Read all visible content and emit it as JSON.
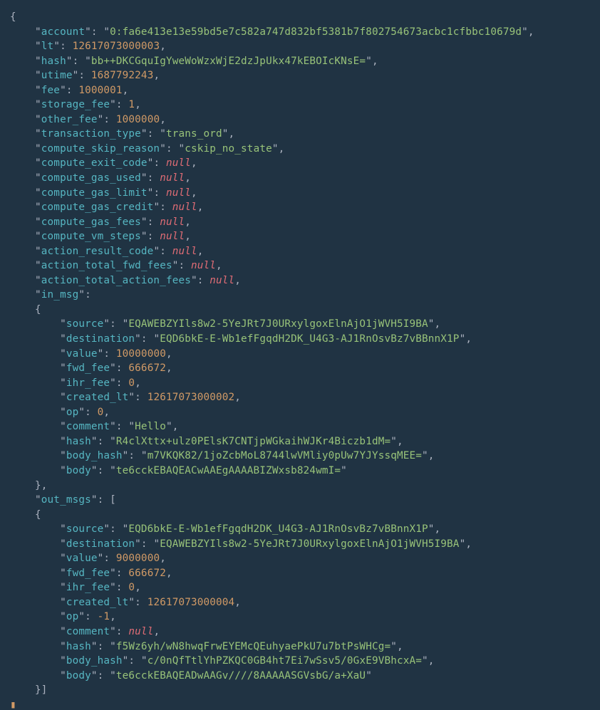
{
  "transaction": {
    "account": "0:fa6e413e13e59bd5e7c582a747d832bf5381b7f802754673acbc1cfbbc10679d",
    "lt": 12617073000003,
    "hash": "bb++DKCGquIgYweWoWzxWjE2dzJpUkx47kEBOIcKNsE=",
    "utime": 1687792243,
    "fee": 1000001,
    "storage_fee": 1,
    "other_fee": 1000000,
    "transaction_type": "trans_ord",
    "compute_skip_reason": "cskip_no_state",
    "compute_exit_code": null,
    "compute_gas_used": null,
    "compute_gas_limit": null,
    "compute_gas_credit": null,
    "compute_gas_fees": null,
    "compute_vm_steps": null,
    "action_result_code": null,
    "action_total_fwd_fees": null,
    "action_total_action_fees": null,
    "in_msg": {
      "source": "EQAWEBZYIls8w2-5YeJRt7J0URxylgoxElnAjO1jWVH5I9BA",
      "destination": "EQD6bkE-E-Wb1efFgqdH2DK_U4G3-AJ1RnOsvBz7vBBnnX1P",
      "value": 10000000,
      "fwd_fee": 666672,
      "ihr_fee": 0,
      "created_lt": 12617073000002,
      "op": 0,
      "comment": "Hello",
      "hash": "R4clXttx+ulz0PElsK7CNTjpWGkaihWJKr4Biczb1dM=",
      "body_hash": "m7VKQK82/1joZcbMoL8744lwVMliy0pUw7YJYssqMEE=",
      "body": "te6cckEBAQEACwAAEgAAAABIZWxsb824wmI="
    },
    "out_msgs": [
      {
        "source": "EQD6bkE-E-Wb1efFgqdH2DK_U4G3-AJ1RnOsvBz7vBBnnX1P",
        "destination": "EQAWEBZYIls8w2-5YeJRt7J0URxylgoxElnAjO1jWVH5I9BA",
        "value": 9000000,
        "fwd_fee": 666672,
        "ihr_fee": 0,
        "created_lt": 12617073000004,
        "op": -1,
        "comment": null,
        "hash": "f5Wz6yh/wN8hwqFrwEYEMcQEuhyaePkU7u7btPsWHCg=",
        "body_hash": "c/0nQfTtlYhPZKQC0GB4ht7Ei7wSsv5/0GxE9VBhcxA=",
        "body": "te6cckEBAQEADwAAGv////8AAAAASGVsbG/a+XaU"
      }
    ]
  },
  "labels": {
    "account": "account",
    "lt": "lt",
    "hash": "hash",
    "utime": "utime",
    "fee": "fee",
    "storage_fee": "storage_fee",
    "other_fee": "other_fee",
    "transaction_type": "transaction_type",
    "compute_skip_reason": "compute_skip_reason",
    "compute_exit_code": "compute_exit_code",
    "compute_gas_used": "compute_gas_used",
    "compute_gas_limit": "compute_gas_limit",
    "compute_gas_credit": "compute_gas_credit",
    "compute_gas_fees": "compute_gas_fees",
    "compute_vm_steps": "compute_vm_steps",
    "action_result_code": "action_result_code",
    "action_total_fwd_fees": "action_total_fwd_fees",
    "action_total_action_fees": "action_total_action_fees",
    "in_msg": "in_msg",
    "out_msgs": "out_msgs",
    "source": "source",
    "destination": "destination",
    "value": "value",
    "fwd_fee": "fwd_fee",
    "ihr_fee": "ihr_fee",
    "created_lt": "created_lt",
    "op": "op",
    "comment": "comment",
    "body_hash": "body_hash",
    "body": "body"
  },
  "null_token": "null"
}
